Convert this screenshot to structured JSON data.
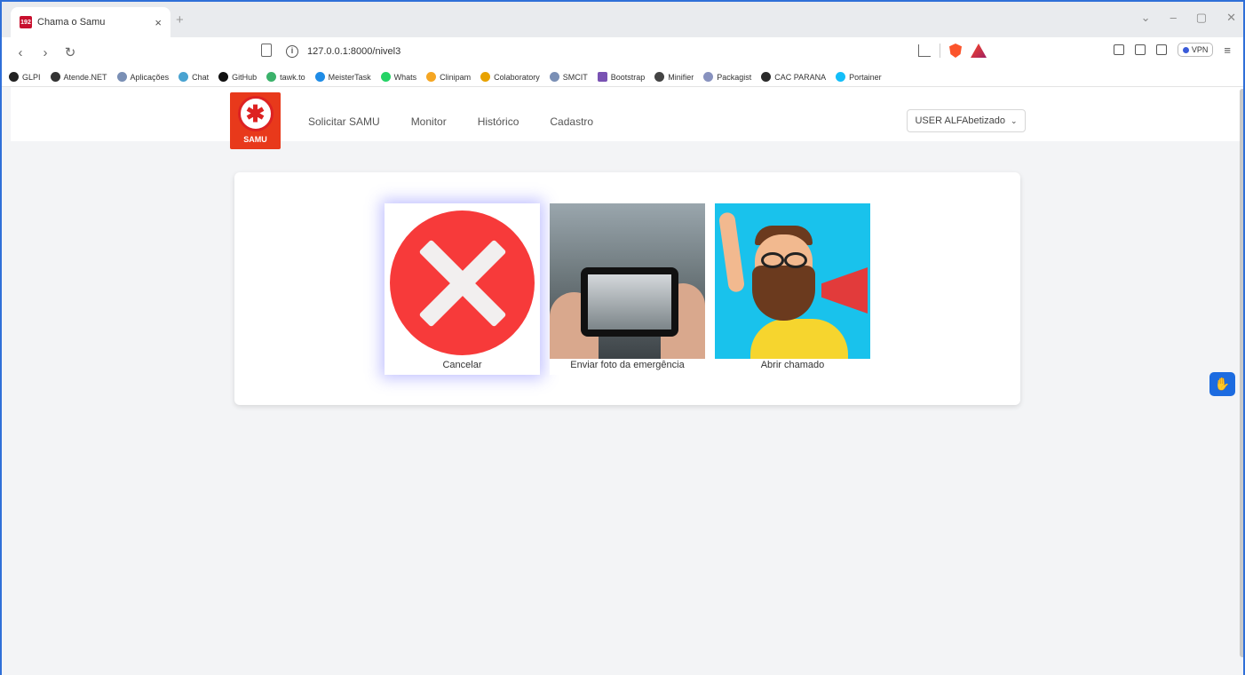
{
  "browser": {
    "tab_title": "Chama o Samu",
    "tab_favicon": "192",
    "url": "127.0.0.1:8000/nivel3",
    "vpn_label": "VPN",
    "bookmarks": [
      "GLPI",
      "Atende.NET",
      "Aplicações",
      "Chat",
      "GitHub",
      "tawk.to",
      "MeisterTask",
      "Whats",
      "Clinipam",
      "Colaboratory",
      "SMCIT",
      "Bootstrap",
      "Minifier",
      "Packagist",
      "CAC PARANA",
      "Portainer"
    ]
  },
  "navbar": {
    "logo_text": "SAMU",
    "links": [
      "Solicitar SAMU",
      "Monitor",
      "Histórico",
      "Cadastro"
    ],
    "user": "USER ALFAbetizado"
  },
  "options": [
    {
      "label": "Cancelar",
      "icon": "cancel-x-icon"
    },
    {
      "label": "Enviar foto da emergência",
      "icon": "phone-photo-image"
    },
    {
      "label": "Abrir chamado",
      "icon": "megaphone-man-image"
    }
  ],
  "colors": {
    "accent": "#2f6fd8",
    "samu_red": "#e8391b",
    "cancel_red": "#f73a3a",
    "access_blue": "#1c6be0"
  }
}
